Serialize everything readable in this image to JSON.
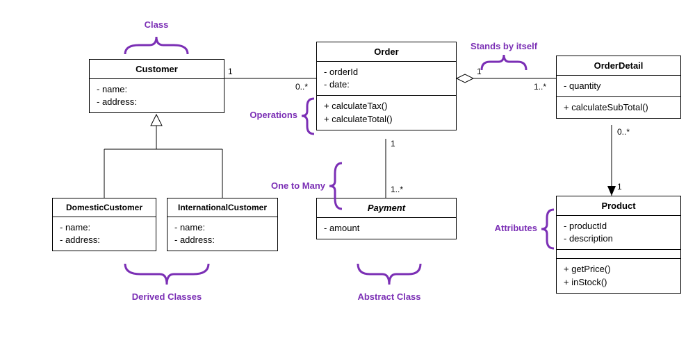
{
  "classes": {
    "customer": {
      "name": "Customer",
      "attrs": [
        "- name:",
        "- address:"
      ]
    },
    "order": {
      "name": "Order",
      "attrs": [
        "- orderId",
        "- date:"
      ],
      "ops": [
        "+ calculateTax()",
        "+ calculateTotal()"
      ]
    },
    "orderDetail": {
      "name": "OrderDetail",
      "attrs": [
        "- quantity"
      ],
      "ops": [
        "+ calculateSubTotal()"
      ]
    },
    "domesticCustomer": {
      "name": "DomesticCustomer",
      "attrs": [
        "- name:",
        "- address:"
      ]
    },
    "internationalCustomer": {
      "name": "InternationalCustomer",
      "attrs": [
        "- name:",
        "- address:"
      ]
    },
    "payment": {
      "name": "Payment",
      "attrs": [
        "- amount"
      ]
    },
    "product": {
      "name": "Product",
      "attrs": [
        "- productId",
        "- description"
      ],
      "ops": [
        "+ getPrice()",
        "+ inStock()"
      ]
    }
  },
  "annotations": {
    "classLabel": "Class",
    "operations": "Operations",
    "standsByItself": "Stands by itself",
    "oneToMany": "One to Many",
    "attributes": "Attributes",
    "derivedClasses": "Derived Classes",
    "abstractClass": "Abstract Class"
  },
  "multiplicities": {
    "customerOrder_customer": "1",
    "customerOrder_order": "0..*",
    "orderPayment_order": "1",
    "orderPayment_payment": "1..*",
    "orderOrderDetail_order": "1",
    "orderOrderDetail_detail": "1..*",
    "orderDetailProduct_detail": "0..*",
    "orderDetailProduct_product": "1"
  }
}
